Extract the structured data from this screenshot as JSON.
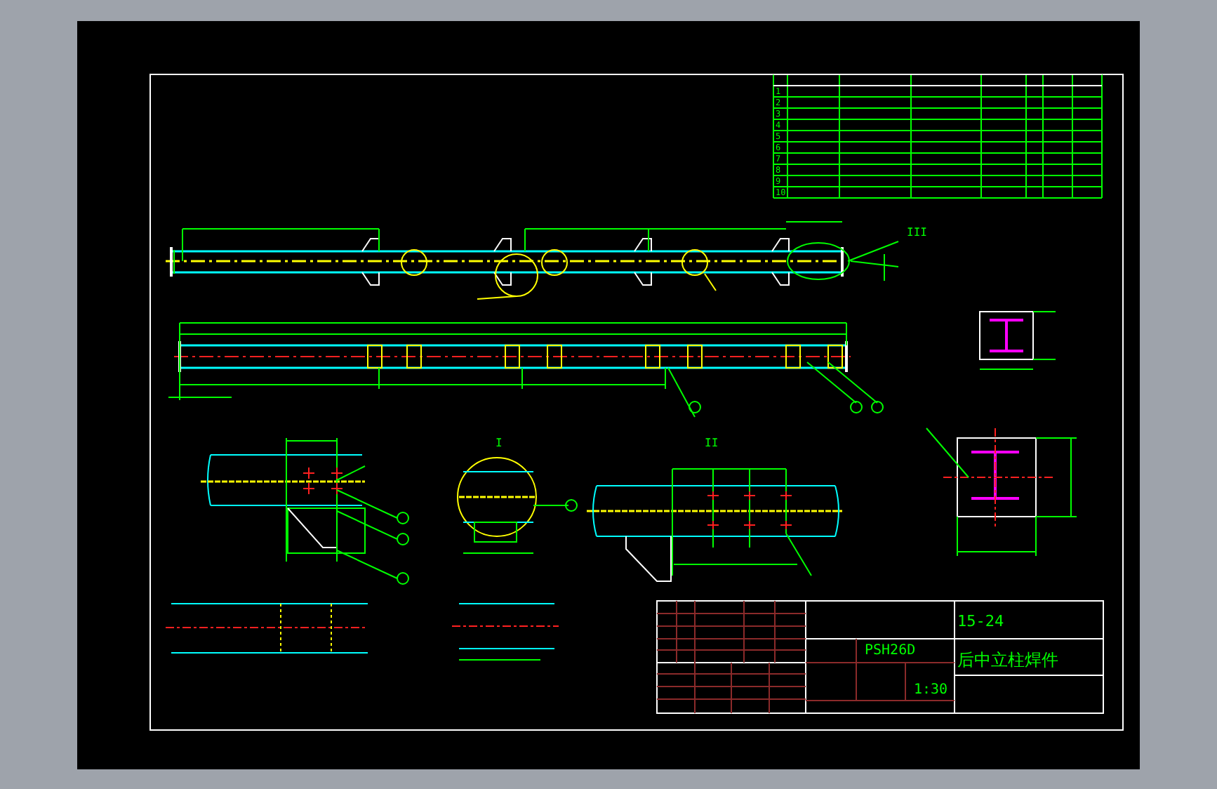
{
  "parts_table": {
    "item_numbers": [
      "1",
      "2",
      "3",
      "4",
      "5",
      "6",
      "7",
      "8",
      "9",
      "10"
    ]
  },
  "view_labels": [
    {
      "label": "I"
    },
    {
      "label": "II"
    },
    {
      "label": "III"
    }
  ],
  "title_block": {
    "drawing_number": "15-24",
    "model": "PSH26D",
    "part_name": "后中立柱焊件",
    "scale": "1:30"
  }
}
